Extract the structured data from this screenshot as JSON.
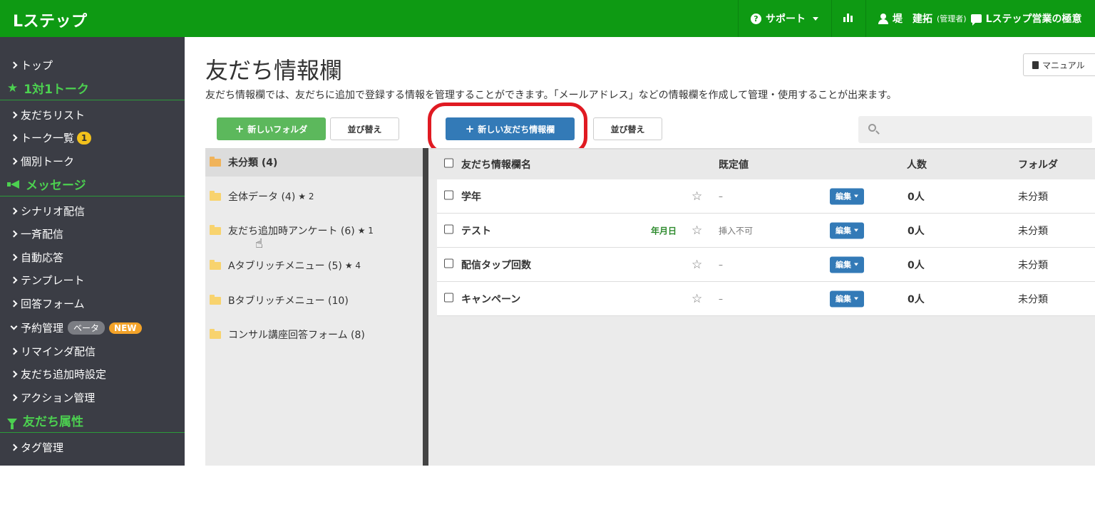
{
  "header": {
    "logo": "Lステップ",
    "support_label": "サポート",
    "user_name": "堤　建拓",
    "user_role": "(管理者)",
    "account_name": "Lステップ営業の極意"
  },
  "sidebar": {
    "top": "トップ",
    "section_talk": "1対1トーク",
    "friend_list": "友だちリスト",
    "talk_list": "トーク一覧",
    "talk_badge": "1",
    "individual_talk": "個別トーク",
    "section_message": "メッセージ",
    "scenario": "シナリオ配信",
    "broadcast": "一斉配信",
    "auto_reply": "自動応答",
    "template": "テンプレート",
    "answer_form": "回答フォーム",
    "reservation": "予約管理",
    "beta_badge": "ベータ",
    "new_badge": "NEW",
    "reminder": "リマインダ配信",
    "friend_add_setting": "友だち追加時設定",
    "action_mgmt": "アクション管理",
    "section_attr": "友だち属性",
    "tag_mgmt": "タグ管理"
  },
  "main": {
    "title": "友だち情報欄",
    "manual_label": "マニュアル",
    "description": "友だち情報欄では、友だちに追加で登録する情報を管理することができます。「メールアドレス」などの情報欄を作成して管理・使用することが出来ます。",
    "new_folder_label": "新しいフォルダ",
    "sort_label_1": "並び替え",
    "new_field_label": "新しい友だち情報欄",
    "sort_label_2": "並び替え",
    "search_placeholder": ""
  },
  "folders": [
    {
      "name": "未分類 (4)",
      "stars": ""
    },
    {
      "name": "全体データ (4)",
      "stars": "★ 2"
    },
    {
      "name": "友だち追加時アンケート (6)",
      "stars": "★ 1"
    },
    {
      "name": "Aタブリッチメニュー (5)",
      "stars": "★ 4"
    },
    {
      "name": "Bタブリッチメニュー (10)",
      "stars": ""
    },
    {
      "name": "コンサル講座回答フォーム (8)",
      "stars": ""
    }
  ],
  "table": {
    "headers": {
      "name": "友だち情報欄名",
      "default": "既定値",
      "count": "人数",
      "folder": "フォルダ"
    },
    "rows": [
      {
        "name": "学年",
        "type": "",
        "default": "–",
        "edit": "編集",
        "count": "0人",
        "folder": "未分類"
      },
      {
        "name": "テスト",
        "type": "年月日",
        "default": "挿入不可",
        "edit": "編集",
        "count": "0人",
        "folder": "未分類"
      },
      {
        "name": "配信タップ回数",
        "type": "",
        "default": "–",
        "edit": "編集",
        "count": "0人",
        "folder": "未分類"
      },
      {
        "name": "キャンペーン",
        "type": "",
        "default": "–",
        "edit": "編集",
        "count": "0人",
        "folder": "未分類"
      }
    ]
  },
  "colors": {
    "header_green": "#0e9a13",
    "sidebar_bg": "#3b3d45",
    "sidebar_accent": "#4cd050",
    "primary_blue": "#337ab7",
    "success_green": "#5cb85c",
    "highlight_red": "#e01a22"
  },
  "icons": {
    "support": "question-circle-icon",
    "stats": "bar-chart-icon",
    "user": "user-icon",
    "chat": "chat-icon",
    "manual": "book-icon",
    "search": "search-icon",
    "folder": "folder-icon",
    "star": "star-outline-icon"
  }
}
